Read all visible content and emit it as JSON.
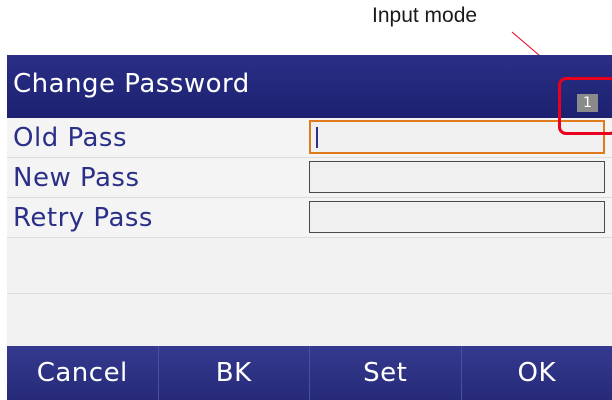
{
  "annotation": {
    "label": "Input mode",
    "highlight_color": "#e8001c"
  },
  "header": {
    "title": "Change Password",
    "input_mode_indicator": "1"
  },
  "form": {
    "fields": [
      {
        "label": "Old Pass",
        "value": "",
        "focused": true
      },
      {
        "label": "New Pass",
        "value": "",
        "focused": false
      },
      {
        "label": "Retry Pass",
        "value": "",
        "focused": false
      }
    ]
  },
  "softkeys": [
    {
      "label": "Cancel"
    },
    {
      "label": "BK"
    },
    {
      "label": "Set"
    },
    {
      "label": "OK"
    }
  ],
  "colors": {
    "titlebar": "#1d2170",
    "label_text": "#2a2f87",
    "focus_border": "#e07a1e"
  }
}
